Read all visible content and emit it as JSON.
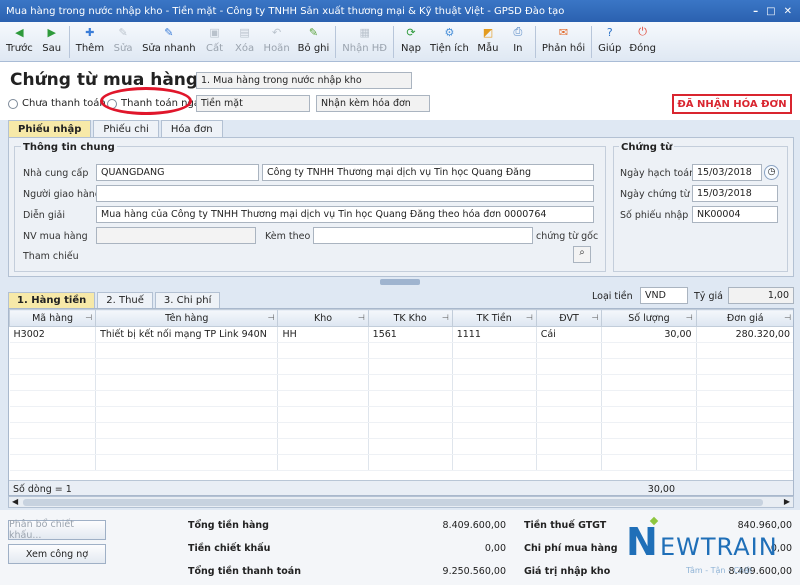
{
  "window": {
    "title": "Mua hàng trong nước nhập kho - Tiền mặt - Công ty TNHH Sản xuất thương mại & Kỹ thuật Việt - GPSD Đào tạo"
  },
  "toolbar": {
    "items": [
      {
        "label": "Trước",
        "icon": "arrow-left-icon",
        "color": "#2e9a3b"
      },
      {
        "label": "Sau",
        "icon": "arrow-right-icon",
        "color": "#2e9a3b"
      },
      {
        "label": "Thêm",
        "icon": "add-document-icon",
        "color": "#3b7dd8"
      },
      {
        "label": "Sửa",
        "icon": "edit-icon",
        "color": "#7a8796"
      },
      {
        "label": "Sửa nhanh",
        "icon": "quick-edit-icon",
        "color": "#3b7dd8"
      },
      {
        "label": "Cất",
        "icon": "save-icon",
        "color": "#7a8796"
      },
      {
        "label": "Xóa",
        "icon": "delete-icon",
        "color": "#7a8796"
      },
      {
        "label": "Hoãn",
        "icon": "undo-icon",
        "color": "#7a8796"
      },
      {
        "label": "Bỏ ghi",
        "icon": "unpost-icon",
        "color": "#58a13a"
      },
      {
        "label": "Nhận HĐ",
        "icon": "receive-invoice-icon",
        "color": "#7a8796"
      },
      {
        "label": "Nạp",
        "icon": "reload-icon",
        "color": "#2e9a3b"
      },
      {
        "label": "Tiện ích",
        "icon": "utilities-icon",
        "color": "#4a90d9"
      },
      {
        "label": "Mẫu",
        "icon": "template-icon",
        "color": "#e39b1f"
      },
      {
        "label": "In",
        "icon": "print-icon",
        "color": "#4a7fc0"
      },
      {
        "label": "Phản hồi",
        "icon": "feedback-mail-icon",
        "color": "#e2692a"
      },
      {
        "label": "Giúp",
        "icon": "help-icon",
        "color": "#2f74c8"
      },
      {
        "label": "Đóng",
        "icon": "close-door-icon",
        "color": "#e04a3a"
      }
    ]
  },
  "header": {
    "title": "Chứng từ mua hàng",
    "type_select": "1. Mua hàng trong nước nhập kho",
    "radio_unpaid": "Chưa thanh toán",
    "radio_paid": "Thanh toán ngay",
    "payment_method": "Tiền mặt",
    "invoice_option": "Nhận kèm hóa đơn",
    "status_stamp": "ĐÃ NHẬN HÓA ĐƠN"
  },
  "tabs": {
    "t1": "Phiếu nhập",
    "t2": "Phiếu chi",
    "t3": "Hóa đơn"
  },
  "general": {
    "title": "Thông tin chung",
    "supplier_label": "Nhà cung cấp",
    "supplier_code": "QUANGDANG",
    "supplier_name": "Công ty TNHH Thương mại dịch vụ Tin học Quang Đăng",
    "deliverer_label": "Người giao hàng",
    "desc_label": "Diễn giải",
    "desc_value": "Mua hàng của Công ty TNHH Thương mại dịch vụ Tin học Quang Đăng theo hóa đơn 0000764",
    "buyer_label": "NV mua hàng",
    "attach_label": "Kèm theo",
    "attach_suffix": "chứng từ gốc",
    "ref_label": "Tham chiếu"
  },
  "voucher": {
    "title": "Chứng từ",
    "post_date_label": "Ngày hạch toán",
    "post_date": "15/03/2018",
    "doc_date_label": "Ngày chứng từ",
    "doc_date": "15/03/2018",
    "number_label": "Số phiếu nhập",
    "number": "NK00004"
  },
  "detail_tabs": {
    "t1": "1. Hàng tiền",
    "t2": "2. Thuế",
    "t3": "3. Chi phí"
  },
  "currency": {
    "label": "Loại tiền",
    "value": "VND",
    "rate_label": "Tỷ giá",
    "rate": "1,00"
  },
  "grid": {
    "columns": [
      "Mã hàng",
      "Tên hàng",
      "Kho",
      "TK Kho",
      "TK Tiền",
      "ĐVT",
      "Số lượng",
      "Đơn giá"
    ],
    "rows": [
      [
        "H3002",
        "Thiết bị kết nối mạng TP Link 940N",
        "HH",
        "1561",
        "1111",
        "Cái",
        "30,00",
        "280.320,00"
      ]
    ],
    "summary_label": "Số dòng = 1",
    "summary_qty": "30,00"
  },
  "footer": {
    "btn_allocate": "Phân bổ chiết khấu...",
    "btn_debt": "Xem công nợ",
    "total_goods_label": "Tổng tiền hàng",
    "total_goods": "8.409.600,00",
    "discount_label": "Tiền chiết khấu",
    "discount": "0,00",
    "total_pay_label": "Tổng tiền thanh toán",
    "total_pay": "9.250.560,00",
    "vat_label": "Tiền thuế GTGT",
    "vat": "840.960,00",
    "purchase_cost_label": "Chi phí mua hàng",
    "purchase_cost": "0,00",
    "stock_value_label": "Giá trị nhập kho",
    "stock_value": "8.409.600,00"
  },
  "logo": {
    "letter": "N",
    "word": "EWTRAIN",
    "slogan": "Tâm - Tận - Chất"
  }
}
